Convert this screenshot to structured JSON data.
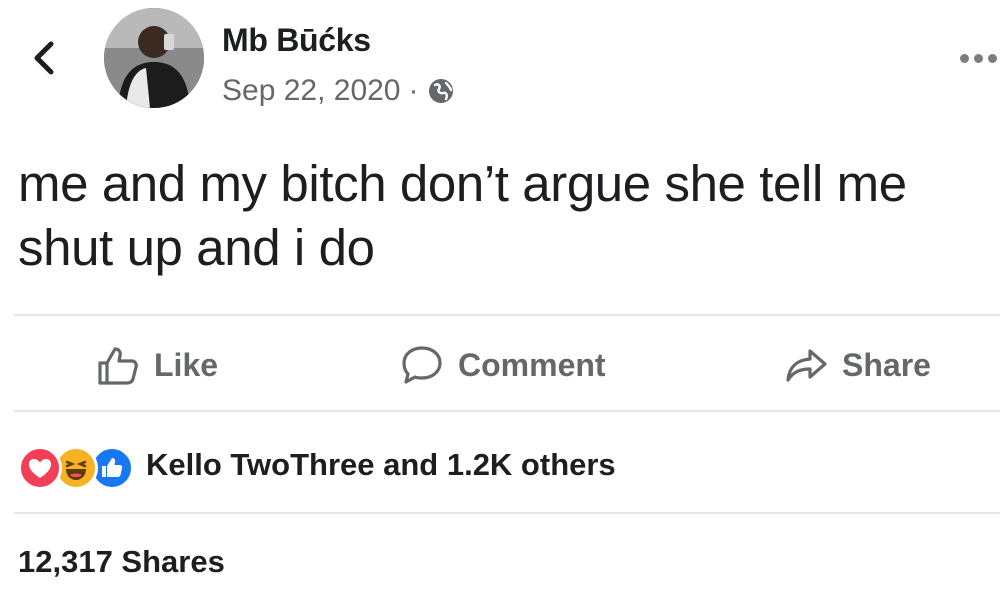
{
  "post": {
    "author": "Mb Būćks",
    "date": "Sep 22, 2020",
    "meta_separator": "·",
    "audience_icon": "globe-icon",
    "text": "me and my bitch don’t argue she tell me\nshut up and i do"
  },
  "actions": {
    "like_label": "Like",
    "comment_label": "Comment",
    "share_label": "Share"
  },
  "reactions": {
    "icons": [
      "love-icon",
      "haha-icon",
      "like-icon"
    ],
    "summary": "Kello TwoThree and 1.2K others"
  },
  "shares": {
    "label": "12,317 Shares"
  },
  "colors": {
    "text": "#1c1e21",
    "secondary": "#65676b",
    "divider": "#e4e6eb",
    "love": "#f33e58",
    "haha": "#f7b125",
    "like": "#1877f2"
  }
}
